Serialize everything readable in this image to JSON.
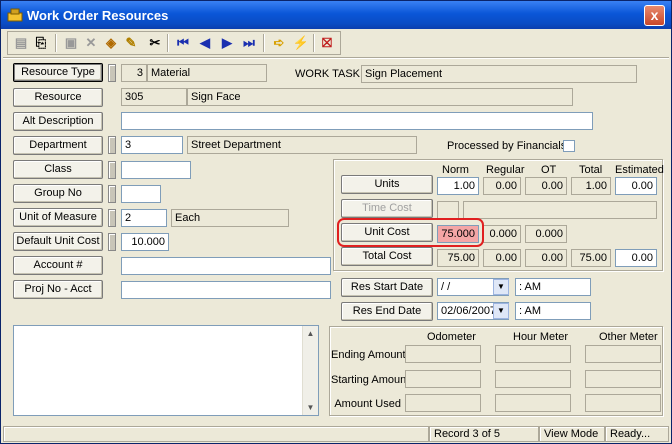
{
  "window": {
    "title": "Work Order Resources",
    "close_label": "x"
  },
  "toolbar": {
    "icons": [
      "properties-icon",
      "preview-icon",
      "save-icon",
      "delete-icon",
      "spellcheck-icon",
      "edit-icon",
      "cut-icon",
      "first-record-icon",
      "previous-record-icon",
      "next-record-icon",
      "last-record-icon",
      "goto-icon",
      "lightning-icon",
      "exit-icon"
    ]
  },
  "form": {
    "resource_type": {
      "label": "Resource Type",
      "code": "3",
      "value": "Material"
    },
    "work_task": {
      "label": "WORK TASK",
      "value": "Sign Placement"
    },
    "resource": {
      "label": "Resource",
      "code": "305",
      "value": "Sign Face"
    },
    "alt_description": {
      "label": "Alt Description",
      "value": ""
    },
    "department": {
      "label": "Department",
      "code": "3",
      "value": "Street Department"
    },
    "processed_by_financials": {
      "label": "Processed by Financials",
      "checked": false
    },
    "class": {
      "label": "Class",
      "value": ""
    },
    "group_no": {
      "label": "Group No",
      "value": ""
    },
    "unit_of_measure": {
      "label": "Unit of Measure",
      "code": "2",
      "value": "Each"
    },
    "default_unit_cost": {
      "label": "Default Unit Cost",
      "value": "10.000"
    },
    "account": {
      "label": "Account #",
      "value": ""
    },
    "proj_no_acct": {
      "label": "Proj No - Acct",
      "value": ""
    }
  },
  "costs": {
    "headers": {
      "norm": "Norm",
      "regular": "Regular",
      "ot": "OT",
      "total": "Total",
      "estimated": "Estimated"
    },
    "units": {
      "label": "Units",
      "norm": "1.00",
      "regular": "0.00",
      "ot": "0.00",
      "total": "1.00",
      "estimated": "0.00"
    },
    "time_cost": {
      "label": "Time Cost",
      "norm": "",
      "rest": ""
    },
    "unit_cost": {
      "label": "Unit Cost",
      "norm": "75.000",
      "regular": "0.000",
      "ot": "0.000"
    },
    "total_cost": {
      "label": "Total Cost",
      "norm": "75.00",
      "regular": "0.00",
      "ot": "0.00",
      "total": "75.00",
      "estimated": "0.00"
    }
  },
  "dates": {
    "start": {
      "label": "Res Start Date",
      "date": "/ /",
      "time": ":  AM"
    },
    "end": {
      "label": "Res End Date",
      "date": "02/06/2007",
      "time": ":  AM"
    }
  },
  "meters": {
    "headers": {
      "odometer": "Odometer",
      "hour_meter": "Hour Meter",
      "other_meter": "Other Meter"
    },
    "rows": [
      "Ending Amount",
      "Starting Amount",
      "Amount Used"
    ]
  },
  "status": {
    "record": "Record 3 of 5",
    "mode": "View Mode",
    "state": "Ready..."
  },
  "colors": {
    "highlight": "#f4a6a6",
    "callout": "#e02020"
  }
}
